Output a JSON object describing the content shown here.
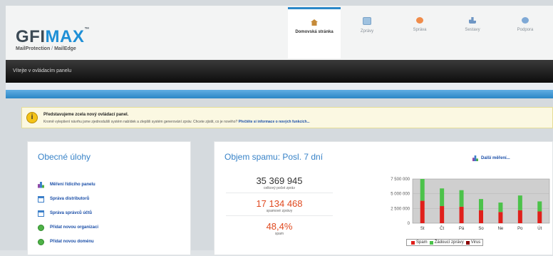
{
  "brand": {
    "logo_gfi": "GFI",
    "logo_max": "MAX",
    "logo_tm": "™",
    "sub_part1": "MailProtection",
    "sub_sep": " / ",
    "sub_part2": "MailEdge"
  },
  "tabs": [
    {
      "label": "Domovská stránka",
      "active": true,
      "icon": "home-icon",
      "color": "#c58b3a"
    },
    {
      "label": "Zprávy",
      "active": false,
      "icon": "envelope-icon",
      "color": "#9fc2e0"
    },
    {
      "label": "Správa",
      "active": false,
      "icon": "gear-icon",
      "color": "#f08c4a"
    },
    {
      "label": "Sestavy",
      "active": false,
      "icon": "chart-icon",
      "color": "#6e96c4"
    },
    {
      "label": "Podpora",
      "active": false,
      "icon": "help-icon",
      "color": "#7fa9d6"
    }
  ],
  "welcome": "Vítejte v ovládacím panelu",
  "notice": {
    "icon": "info-icon",
    "icon_glyph": "i",
    "title": "Představujeme zcela nový ovládací panel.",
    "text": "Kromě vylepšení návrhu jsme zjednodušili systém nabídek a zlepšili systém generování zpráv. Chcete zjistit, co je nového? ",
    "link": "Přečtěte si informace o nových funkcích..."
  },
  "tasks": {
    "title": "Obecné úlohy",
    "items": [
      {
        "label": "Měření řídicího panelu",
        "icon": "chart-icon"
      },
      {
        "label": "Správa distributorů",
        "icon": "document-icon"
      },
      {
        "label": "Správa správců účtů",
        "icon": "document-icon"
      },
      {
        "label": "Přidat novou organizaci",
        "icon": "add-icon"
      },
      {
        "label": "Přidat novou doménu",
        "icon": "add-icon"
      }
    ]
  },
  "spam": {
    "title": "Objem spamu: Posl. 7 dní",
    "more_link": "Další měření...",
    "stats": [
      {
        "value": "35 369 945",
        "label": "celkový počet zpráv",
        "color": "dark"
      },
      {
        "value": "17 134 468",
        "label": "spamové zprávy",
        "color": "red"
      },
      {
        "value": "48,4%",
        "label": "spam",
        "color": "red"
      }
    ]
  },
  "chart_data": {
    "type": "bar",
    "stacked": true,
    "categories": [
      "St",
      "Čt",
      "Pá",
      "So",
      "Ne",
      "Po",
      "Út"
    ],
    "series": [
      {
        "name": "Spam",
        "color": "#e0201b",
        "values": [
          3800000,
          2900000,
          2800000,
          2200000,
          1900000,
          2200000,
          2000000
        ]
      },
      {
        "name": "Žádoucí zprávy",
        "color": "#4cc24a",
        "values": [
          3700000,
          3000000,
          2800000,
          1900000,
          1600000,
          2500000,
          1700000
        ]
      },
      {
        "name": "Virus",
        "color": "#8b0000",
        "values": [
          0,
          0,
          0,
          0,
          0,
          0,
          0
        ]
      }
    ],
    "yticks": [
      "7 500 000",
      "5 000 000",
      "2 500 000",
      "0"
    ],
    "ylim": [
      0,
      7500000
    ],
    "grid": true,
    "legend": "bottom"
  }
}
